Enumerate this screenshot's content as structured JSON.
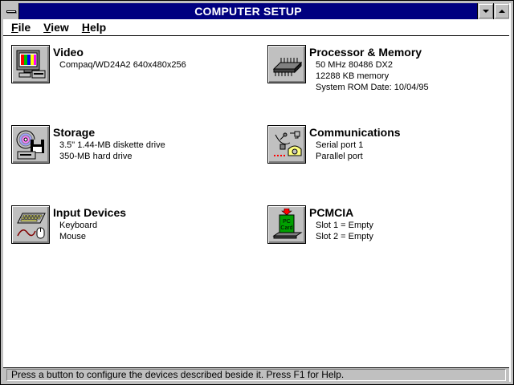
{
  "window": {
    "title": "COMPUTER SETUP"
  },
  "menu": {
    "items": [
      {
        "label_ul": "F",
        "label_rest": "ile"
      },
      {
        "label_ul": "V",
        "label_rest": "iew"
      },
      {
        "label_ul": "H",
        "label_rest": "elp"
      }
    ]
  },
  "devices": {
    "video": {
      "title": "Video",
      "lines": [
        "Compaq/WD24A2 640x480x256"
      ],
      "icon": "monitor-icon"
    },
    "processor": {
      "title": "Processor & Memory",
      "lines": [
        "50 MHz 80486 DX2",
        "12288 KB memory",
        "System ROM Date: 10/04/95"
      ],
      "icon": "chip-icon"
    },
    "storage": {
      "title": "Storage",
      "lines": [
        "3.5\" 1.44-MB diskette drive",
        "350-MB hard drive"
      ],
      "icon": "disk-icon"
    },
    "communications": {
      "title": "Communications",
      "lines": [
        "Serial port 1",
        "Parallel port"
      ],
      "icon": "satellite-phone-icon"
    },
    "input": {
      "title": "Input Devices",
      "lines": [
        "Keyboard",
        "Mouse"
      ],
      "icon": "keyboard-mouse-icon"
    },
    "pcmcia": {
      "title": "PCMCIA",
      "lines": [
        "Slot 1 = Empty",
        "Slot 2 = Empty"
      ],
      "icon": "pc-card-icon",
      "card_label_1": "PC",
      "card_label_2": "Card"
    }
  },
  "status": {
    "text": "Press a button to configure the devices described beside it.  Press F1 for Help."
  },
  "colors": {
    "titlebar": "#000080",
    "face": "#c0c0c0"
  }
}
